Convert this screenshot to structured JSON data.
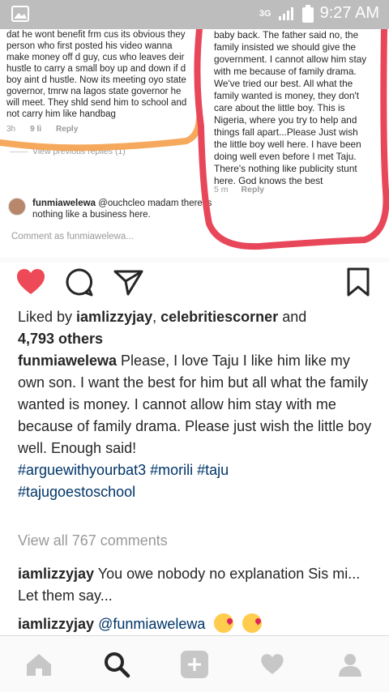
{
  "status_bar": {
    "network": "3G",
    "time": "9:27 AM"
  },
  "embedded_screenshot": {
    "left_comment_text": "dat he wont benefit frm cus its obvious they\nperson who first posted his video wanna\nmake money off d guy, cus who leaves deir\nhustle to carry a small boy up and down if d\nboy aint d hustle. Now its meeting oyo state\ngovernor, tmrw na lagos state governor he\nwill meet. They shld send him to school and\nnot carry him like handbag",
    "left_time": "3h",
    "left_likes": "9 li",
    "left_reply": "Reply",
    "view_previous_replies": "View previous replies (1)",
    "reply_username": "funmiawelewa",
    "reply_text": " @ouchcleo madam there is nothing like a business here.",
    "comment_placeholder": "Comment as funmiawelewa...",
    "right_comment_text": "baby back. The father said no, the\nfamily insisted we should give the\ngovernment. I cannot allow him stay\nwith me because of family drama.\nWe've tried our best. All what the\nfamily wanted is money, they don't\ncare about the little boy. This is\nNigeria, where you try to help and\nthings fall apart...Please Just wish\nthe little boy well here. I have been\ndoing well even before I met Taju.\nThere's nothing like publicity stunt\nhere. God knows the best",
    "right_time": "5 m",
    "right_reply": "Reply"
  },
  "post": {
    "liked_by_prefix": "Liked by ",
    "liked_user_1": "iamlizzyjay",
    "liked_sep": ", ",
    "liked_user_2": "celebritiescorner",
    "liked_and": " and",
    "liked_count": "4,793 others",
    "caption_username": "funmiawelewa",
    "caption_text": " Please, I love Taju I like him like my own son. I want the best for him but all what the family wanted is money. I cannot allow him stay with me because of family drama. Please just wish the little boy well. Enough said!",
    "hashtags_line1": "#arguewithyourbat3 #morili #taju",
    "hashtags_line2": "#tajugoestoschool",
    "view_all_comments": "View all 767 comments"
  },
  "comments": [
    {
      "username": "iamlizzyjay",
      "text": " You owe nobody no explanation Sis mi... Let them say..."
    },
    {
      "username": "iamlizzyjay",
      "mention": " @funmiawelewa"
    }
  ],
  "icons": {
    "like": "heart-icon",
    "comment": "comment-icon",
    "share": "send-icon",
    "save": "bookmark-icon",
    "nav": [
      "home-icon",
      "search-icon",
      "add-icon",
      "activity-heart-icon",
      "profile-icon"
    ]
  },
  "colors": {
    "like_red": "#ed4956",
    "hashtag_blue": "#003569",
    "scribble_orange": "#f5a04a",
    "scribble_red": "#e8475a",
    "muted_gray": "#999999"
  }
}
